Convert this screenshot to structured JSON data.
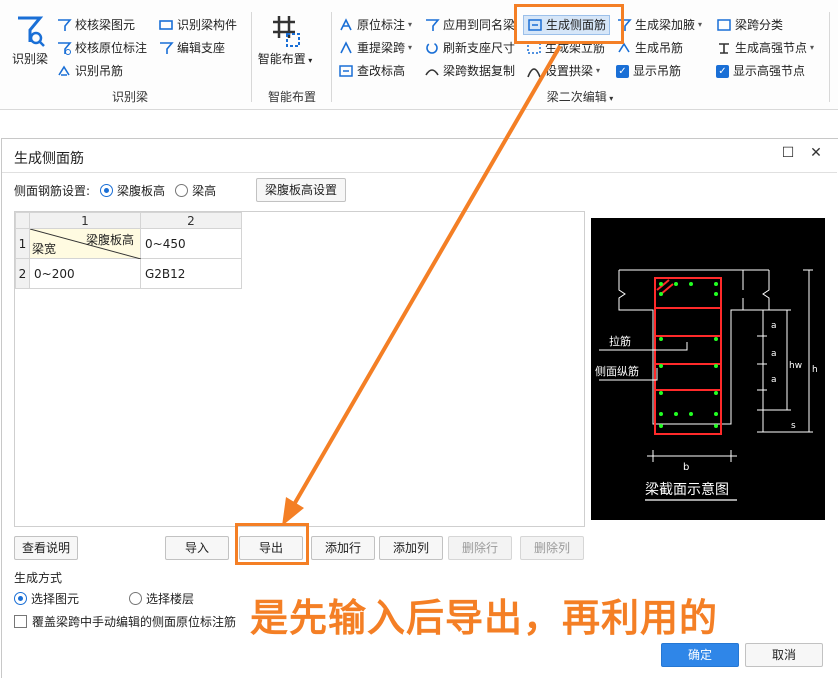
{
  "ribbon": {
    "identify_beam_big": "识别梁",
    "check_beam_element": "校核梁图元",
    "check_original_mark": "校核原位标注",
    "identify_hanger": "识别吊筋",
    "identify_beam_member": "识别梁构件",
    "edit_support": "编辑支座",
    "group_identify": "识别梁",
    "smart_layout": "智能布置",
    "group_smart": "智能布置",
    "original_mark": "原位标注",
    "apply_same_name": "应用到同名梁",
    "generate_side_bar": "生成侧面筋",
    "generate_haunch": "生成梁加腋",
    "span_classify": "梁跨分类",
    "re_extract_span": "重提梁跨",
    "refresh_support_size": "刷新支座尺寸",
    "generate_erection_bar": "生成架立筋",
    "generate_hanger": "生成吊筋",
    "generate_strong_node": "生成高强节点",
    "modify_elevation": "查改标高",
    "copy_span_data": "梁跨数据复制",
    "set_arch": "设置拱梁",
    "show_hanger": "显示吊筋",
    "show_strong_node": "显示高强节点",
    "group_secondary_edit": "梁二次编辑"
  },
  "dialog": {
    "title": "生成侧面筋",
    "setting_label": "侧面钢筋设置:",
    "opt_web_height": "梁腹板高",
    "opt_beam_height": "梁高",
    "web_height_setting_btn": "梁腹板高设置",
    "grid": {
      "col_headers": [
        "1",
        "2"
      ],
      "row_headers": [
        "1",
        "2"
      ],
      "corner_top": "梁腹板高",
      "corner_bottom": "梁宽",
      "r1c2": "0~450",
      "r2c1": "0~200",
      "r2c2": "G2B12"
    },
    "diagram": {
      "label_tie": "拉筋",
      "label_side_long": "侧面纵筋",
      "label_a1": "a",
      "label_a2": "a",
      "label_a3": "a",
      "label_hw": "hw",
      "label_h": "h",
      "label_s": "s",
      "label_b": "b",
      "caption": "梁截面示意图"
    },
    "buttons": {
      "view_help": "查看说明",
      "import": "导入",
      "export": "导出",
      "add_row": "添加行",
      "add_col": "添加列",
      "del_row": "删除行",
      "del_col": "删除列",
      "ok": "确定",
      "cancel": "取消"
    },
    "gen_method": "生成方式",
    "opt_select_element": "选择图元",
    "opt_select_floor": "选择楼层",
    "override_label": "覆盖梁跨中手动编辑的侧面原位标注筋"
  },
  "annotation": "是先输入后导出，再利用的",
  "colors": {
    "accent_orange": "#f47f25",
    "primary_blue": "#2f86e8",
    "icon_blue": "#1a6fd6"
  }
}
